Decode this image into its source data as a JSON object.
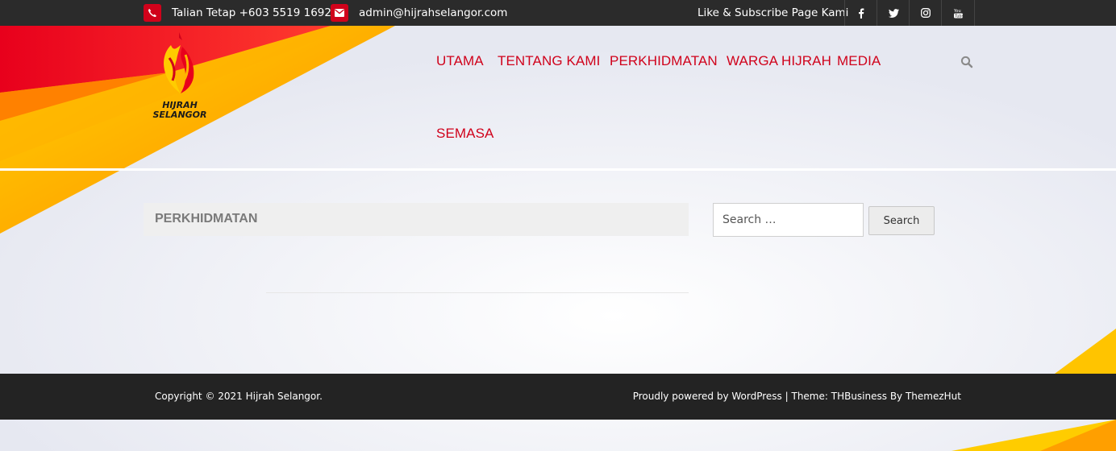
{
  "topbar": {
    "phone": "Talian Tetap +603 5519 1692",
    "email": "admin@hijrahselangor.com",
    "follow": "Like & Subscribe Page Kami",
    "social_icons": [
      "facebook-icon",
      "twitter-icon",
      "instagram-icon",
      "youtube-icon"
    ]
  },
  "logo": {
    "line1": "HIJRAH",
    "line2": "SELANGOR"
  },
  "nav": {
    "items": [
      "UTAMA",
      "TENTANG KAMI",
      "PERKHIDMATAN",
      "WARGA HIJRAH",
      "MEDIA",
      "SEMASA"
    ],
    "search_icon": "search-icon"
  },
  "page": {
    "title": "PERKHIDMATAN"
  },
  "sidebar": {
    "search_placeholder": "Search …",
    "search_button": "Search"
  },
  "footer": {
    "copyright": "Copyright © 2021 Hijrah Selangor.",
    "credit": "Proudly powered by WordPress | Theme: THBusiness By ThemezHut"
  },
  "colors": {
    "brand_red": "#d0021b",
    "brand_yellow": "#ffd400",
    "topbar": "#2b2b2b",
    "footer": "#232323"
  }
}
